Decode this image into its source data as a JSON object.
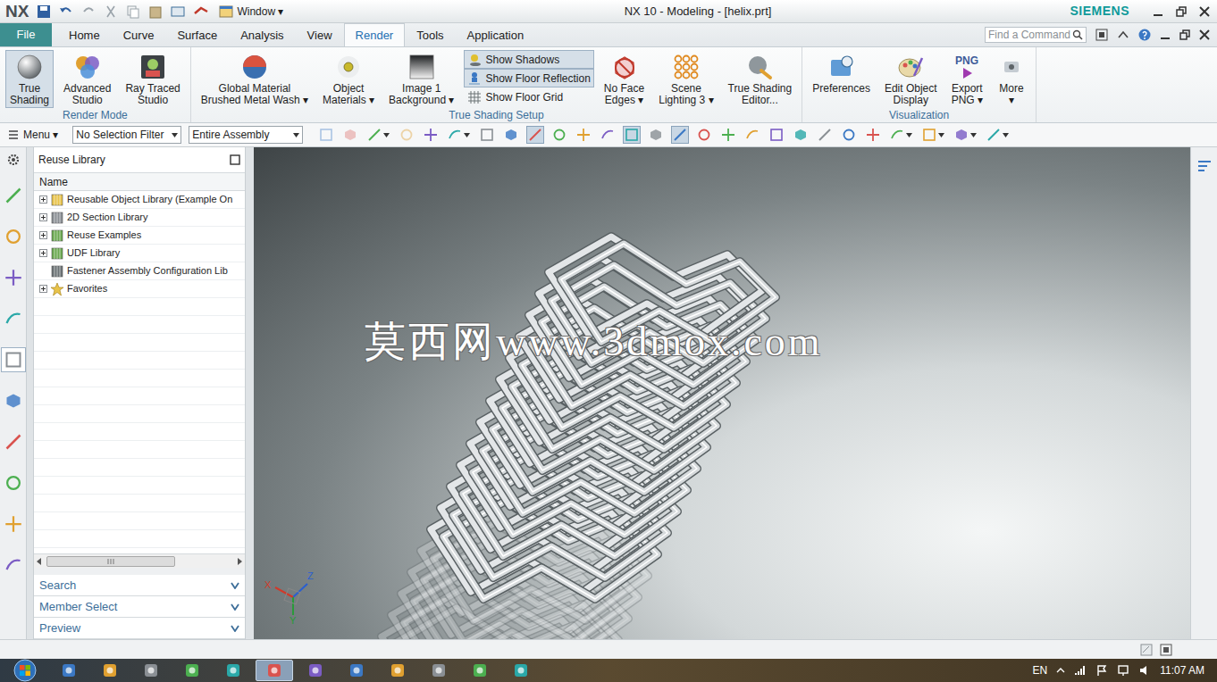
{
  "window": {
    "logo": "NX",
    "title": "NX 10 - Modeling - [helix.prt]",
    "brand": "SIEMENS",
    "window_menu": "Window ▾"
  },
  "file_tab": {
    "label": "File"
  },
  "tabs": [
    {
      "label": "Home",
      "selected": false
    },
    {
      "label": "Curve",
      "selected": false
    },
    {
      "label": "Surface",
      "selected": false
    },
    {
      "label": "Analysis",
      "selected": false
    },
    {
      "label": "View",
      "selected": false
    },
    {
      "label": "Render",
      "selected": true
    },
    {
      "label": "Tools",
      "selected": false
    },
    {
      "label": "Application",
      "selected": false
    }
  ],
  "search": {
    "placeholder": "Find a Command"
  },
  "ribbon_groups": [
    {
      "label": "Render Mode",
      "items": [
        {
          "kind": "large",
          "lines": [
            "True",
            "Shading"
          ],
          "selected": true
        },
        {
          "kind": "large",
          "lines": [
            "Advanced",
            "Studio"
          ],
          "selected": false
        },
        {
          "kind": "large",
          "lines": [
            "Ray Traced",
            "Studio"
          ],
          "selected": false
        }
      ]
    },
    {
      "label": "True Shading Setup",
      "items": [
        {
          "kind": "large",
          "lines": [
            "Global Material",
            "Brushed Metal Wash ▾"
          ],
          "selected": false
        },
        {
          "kind": "large",
          "lines": [
            "Object",
            "Materials ▾"
          ],
          "selected": false
        },
        {
          "kind": "large",
          "lines": [
            "Image 1",
            "Background ▾"
          ],
          "selected": false
        },
        {
          "kind": "stack",
          "entries": [
            {
              "label": "Show Shadows",
              "selected": true
            },
            {
              "label": "Show Floor Reflection",
              "selected": true
            },
            {
              "label": "Show Floor Grid",
              "selected": false
            }
          ]
        },
        {
          "kind": "large",
          "lines": [
            "No Face",
            "Edges ▾"
          ],
          "selected": false
        },
        {
          "kind": "large",
          "lines": [
            "Scene",
            "Lighting 3 ▾"
          ],
          "selected": false
        },
        {
          "kind": "large",
          "lines": [
            "True Shading",
            "Editor..."
          ],
          "selected": false
        }
      ]
    },
    {
      "label": "Visualization",
      "items": [
        {
          "kind": "large",
          "lines": [
            "Preferences"
          ],
          "selected": false
        },
        {
          "kind": "large",
          "lines": [
            "Edit Object",
            "Display"
          ],
          "selected": false
        },
        {
          "kind": "large",
          "lines": [
            "Export",
            "PNG ▾"
          ],
          "selected": false,
          "icon_text": "PNG"
        },
        {
          "kind": "large",
          "lines": [
            "More",
            "▾"
          ],
          "selected": false
        }
      ]
    }
  ],
  "toolbar": {
    "menu": "Menu ▾",
    "selection_filter": "No Selection Filter",
    "scope": "Entire Assembly",
    "icons": [
      {
        "dropdown": false,
        "selected": false,
        "disabled": true
      },
      {
        "dropdown": false,
        "selected": false,
        "disabled": true
      },
      {
        "dropdown": true,
        "selected": false,
        "disabled": false
      },
      {
        "dropdown": false,
        "selected": false,
        "disabled": true
      },
      {
        "dropdown": false,
        "selected": false,
        "disabled": false
      },
      {
        "dropdown": true,
        "selected": false,
        "disabled": false
      },
      {
        "dropdown": false,
        "selected": false,
        "disabled": false
      },
      {
        "dropdown": false,
        "selected": false,
        "disabled": false
      },
      {
        "dropdown": false,
        "selected": true,
        "disabled": false
      },
      {
        "dropdown": false,
        "selected": false,
        "disabled": false
      },
      {
        "dropdown": false,
        "selected": false,
        "disabled": false
      },
      {
        "dropdown": false,
        "selected": false,
        "disabled": false
      },
      {
        "dropdown": false,
        "selected": true,
        "disabled": false
      },
      {
        "dropdown": false,
        "selected": false,
        "disabled": false
      },
      {
        "dropdown": false,
        "selected": true,
        "disabled": false
      },
      {
        "dropdown": false,
        "selected": false,
        "disabled": false
      },
      {
        "dropdown": false,
        "selected": false,
        "disabled": false
      },
      {
        "dropdown": false,
        "selected": false,
        "disabled": false
      },
      {
        "dropdown": false,
        "selected": false,
        "disabled": false
      },
      {
        "dropdown": false,
        "selected": false,
        "disabled": false
      },
      {
        "dropdown": false,
        "selected": false,
        "disabled": false
      },
      {
        "dropdown": false,
        "selected": false,
        "disabled": false
      },
      {
        "dropdown": false,
        "selected": false,
        "disabled": false
      },
      {
        "dropdown": true,
        "selected": false,
        "disabled": false
      },
      {
        "dropdown": true,
        "selected": false,
        "disabled": false
      },
      {
        "dropdown": true,
        "selected": false,
        "disabled": false
      },
      {
        "dropdown": true,
        "selected": false,
        "disabled": false
      }
    ]
  },
  "left_rail": [
    {
      "selected": false
    },
    {
      "selected": false
    },
    {
      "selected": false
    },
    {
      "selected": false
    },
    {
      "selected": true
    },
    {
      "selected": false
    },
    {
      "selected": false
    },
    {
      "selected": false
    },
    {
      "selected": false
    },
    {
      "selected": false
    }
  ],
  "reuse_library": {
    "title": "Reuse Library",
    "column": "Name",
    "items": [
      {
        "label": "Reusable Object Library (Example On",
        "expandable": true,
        "expanded": false
      },
      {
        "label": "2D Section Library",
        "expandable": true,
        "expanded": false
      },
      {
        "label": "Reuse Examples",
        "expandable": true,
        "expanded": false
      },
      {
        "label": "UDF Library",
        "expandable": true,
        "expanded": false
      },
      {
        "label": "Fastener Assembly Configuration Lib",
        "expandable": false,
        "expanded": false
      },
      {
        "label": "Favorites",
        "expandable": true,
        "expanded": false
      }
    ],
    "sections": [
      {
        "label": "Search",
        "expanded": false
      },
      {
        "label": "Member Select",
        "expanded": false
      },
      {
        "label": "Preview",
        "expanded": false
      }
    ]
  },
  "viewport": {
    "watermark": "莫西网www.3dmox.com",
    "triad": {
      "x": "X",
      "y": "Y",
      "z": "Z"
    }
  },
  "taskbar": {
    "apps": [
      {
        "selected": false
      },
      {
        "selected": false
      },
      {
        "selected": false
      },
      {
        "selected": false
      },
      {
        "selected": false
      },
      {
        "selected": true
      },
      {
        "selected": false
      },
      {
        "selected": false
      },
      {
        "selected": false
      },
      {
        "selected": false
      },
      {
        "selected": false
      },
      {
        "selected": false
      }
    ],
    "language": "EN",
    "time": "11:07 AM"
  }
}
